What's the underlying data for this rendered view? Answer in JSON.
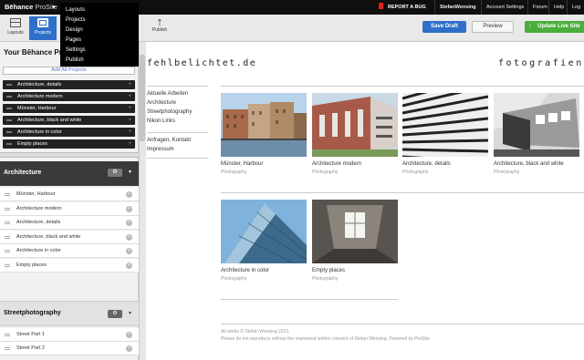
{
  "topbar": {
    "brand_bold": "Bēhance",
    "brand_thin": "ProSite",
    "caret": "▸",
    "bug": "REPORT A BUG",
    "user": "StefanWensing",
    "links": [
      "Account Settings",
      "Forum",
      "Help",
      "Log O"
    ]
  },
  "menu": {
    "items": [
      "Layouts",
      "Projects",
      "Design",
      "Pages",
      "Settings",
      "Publish"
    ]
  },
  "toolbar": {
    "layouts": "Layouts",
    "projects": "Projects",
    "publish": "Publish",
    "save": "Save Draft",
    "preview": "Preview",
    "update": "Update Live Site"
  },
  "sidebar": {
    "title": "Your Bēhance Pro",
    "add_all": "Add All Projects",
    "projects": [
      "Architecture, details",
      "Architecture modern",
      "Münster, Harbour",
      "Architecture, black and white",
      "Architecture in color",
      "Empty places"
    ],
    "section1": {
      "title": "Architecture",
      "items": [
        "Münster, Harbour",
        "Architecture modern",
        "Architecture, details",
        "Architecture, black and white",
        "Architecture in color",
        "Empty places"
      ]
    },
    "section2": {
      "title": "Streetphotography",
      "items": [
        "Street Part 1",
        "Street Part 2"
      ]
    }
  },
  "site": {
    "logo": "fehlbelichtet.de",
    "tagline": "fotografien vo",
    "nav1": [
      "Aktuelle Arbeiten",
      "Architecture",
      "Streetphotography",
      "Nikon Links"
    ],
    "nav2": [
      "Anfragen, Kontakt",
      "Impressum"
    ],
    "cards": [
      {
        "title": "Münster, Harbour",
        "sub": "Photography"
      },
      {
        "title": "Architecture modern",
        "sub": "Photography"
      },
      {
        "title": "Architecture, details",
        "sub": "Photography"
      },
      {
        "title": "Architecture, black and white",
        "sub": "Photography"
      },
      {
        "title": "Architecture in color",
        "sub": "Photography"
      },
      {
        "title": "Empty places",
        "sub": "Photography"
      }
    ],
    "footer1": "All works © Stefan Wensing 2013.",
    "footer2": "Please do not reproduce without the expressed written consent of Stefan Wensing. Powered by ProSite."
  },
  "colors": {
    "accent": "#2f6fca",
    "update_green": "#4aae3b",
    "bug_red": "#e02020"
  }
}
